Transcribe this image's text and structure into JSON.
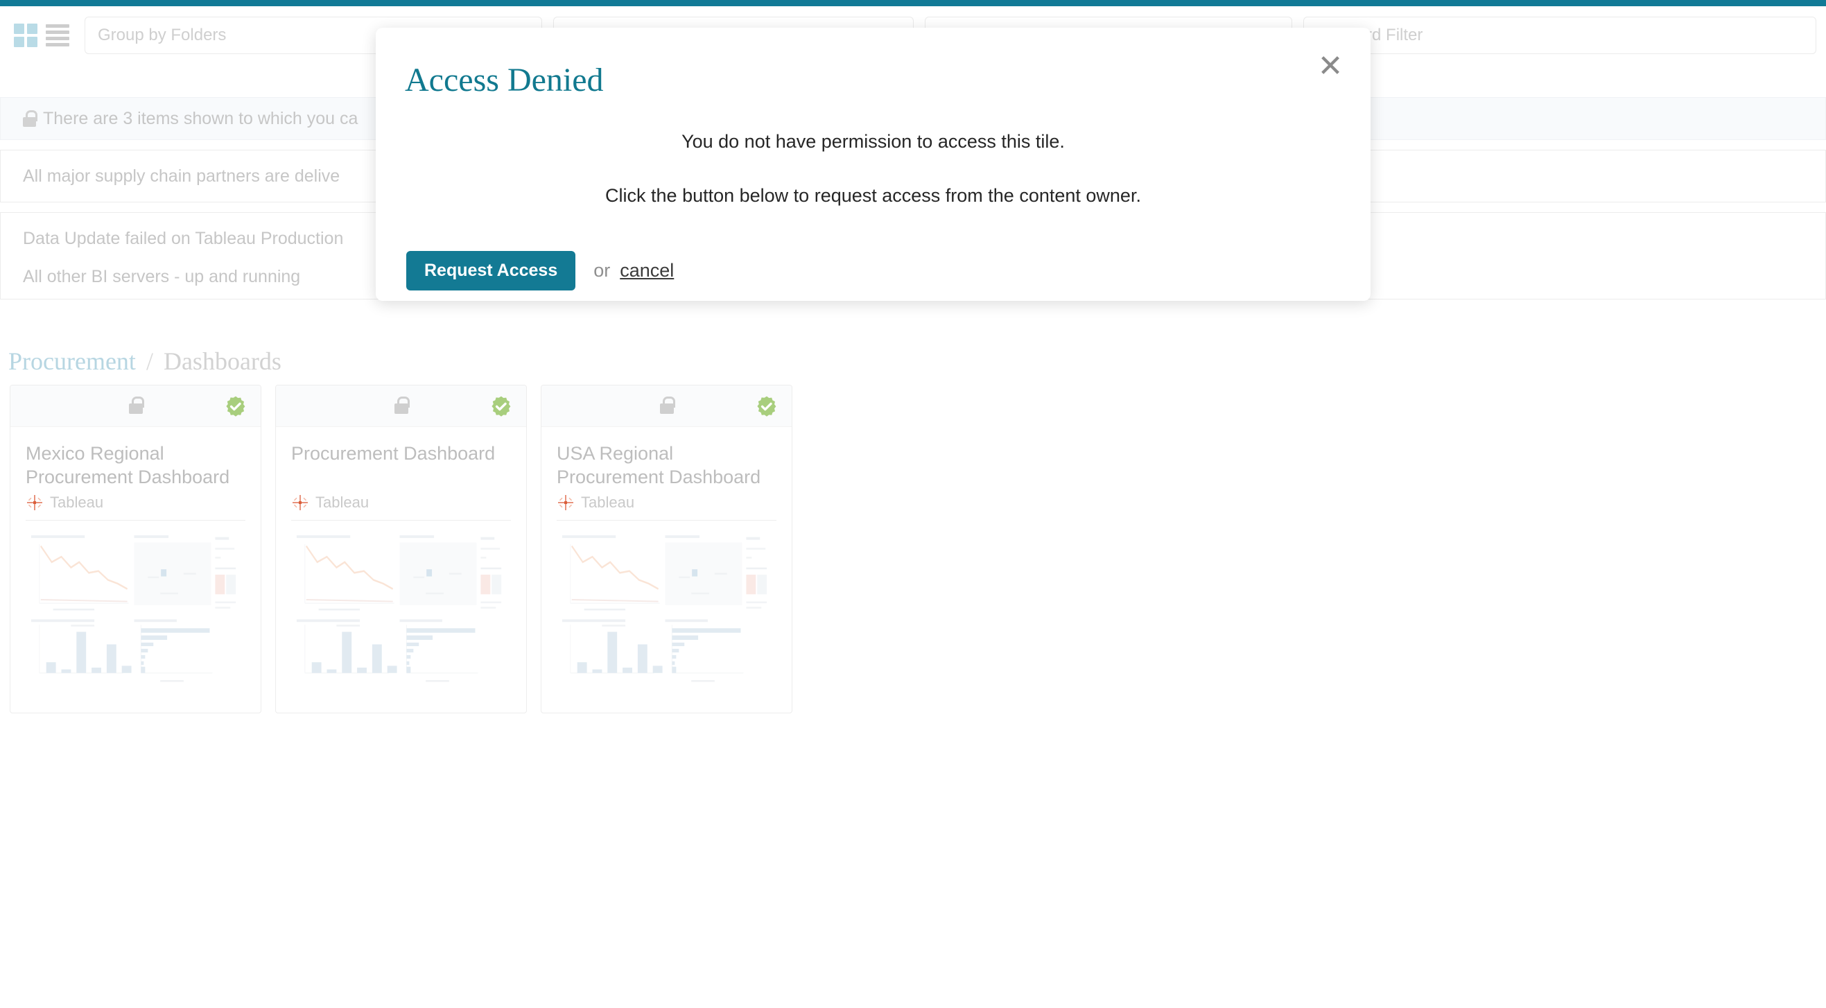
{
  "theme": {
    "accent": "#117a96",
    "accent_button": "#137a94",
    "breadcrumb_root": "#b7d6e2",
    "verified_green": "#a8ce7d",
    "muted_text": "#c6c6c6"
  },
  "topbar": {
    "present": true
  },
  "toolbar": {
    "grid_view_icon": "grid-view-icon",
    "list_view_icon": "list-view-icon",
    "fields": [
      {
        "name": "group-by-folders-input",
        "placeholder": "Group by Folders",
        "value": ""
      },
      {
        "name": "filter-input-2",
        "placeholder": "",
        "value": ""
      },
      {
        "name": "filter-input-3",
        "placeholder": "",
        "value": ""
      },
      {
        "name": "keyword-filter-input",
        "placeholder": "Keyword Filter",
        "value": ""
      }
    ]
  },
  "banners": {
    "lock_notice": {
      "icon": "lock-icon",
      "text": "There are 3 items shown to which you ca"
    },
    "announcement": {
      "text": "All major supply chain partners are delive"
    },
    "status": {
      "line1": "Data Update failed on Tableau Production",
      "line2": "All other BI servers - up and running"
    }
  },
  "breadcrumb": {
    "root": "Procurement",
    "separator": "/",
    "leaf": "Dashboards"
  },
  "cards": [
    {
      "title": "Mexico Regional Procurement Dashboard",
      "source": "Tableau",
      "lock_icon": "lock-icon",
      "verified_icon": "verified-check-icon",
      "source_icon": "tableau-logo-icon"
    },
    {
      "title": "Procurement Dashboard",
      "source": "Tableau",
      "lock_icon": "lock-icon",
      "verified_icon": "verified-check-icon",
      "source_icon": "tableau-logo-icon"
    },
    {
      "title": "USA Regional Procurement Dashboard",
      "source": "Tableau",
      "lock_icon": "lock-icon",
      "verified_icon": "verified-check-icon",
      "source_icon": "tableau-logo-icon"
    }
  ],
  "modal": {
    "title": "Access Denied",
    "close_icon": "close-icon",
    "message_line1": "You do not have permission to access this tile.",
    "message_line2": "Click the button below to request access from the content owner.",
    "primary_button": "Request Access",
    "or_label": "or",
    "cancel_label": "cancel"
  }
}
